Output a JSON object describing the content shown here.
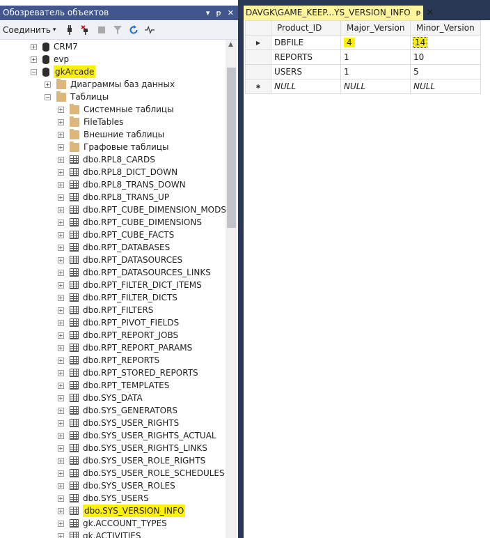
{
  "object_explorer": {
    "title": "Обозреватель объектов",
    "title_controls": [
      "▾",
      "ᵽ",
      "✕"
    ],
    "connect_label": "Соединить",
    "tree": [
      {
        "label": "CRM7",
        "type": "database",
        "level": 0,
        "expander": "+"
      },
      {
        "label": "evp",
        "type": "database",
        "level": 0,
        "expander": "+"
      },
      {
        "label": "gkArcade",
        "type": "database",
        "level": 0,
        "expander": "−",
        "highlight": true
      },
      {
        "label": "Диаграммы баз данных",
        "type": "folder",
        "level": 1,
        "expander": "+"
      },
      {
        "label": "Таблицы",
        "type": "folder",
        "level": 1,
        "expander": "−"
      },
      {
        "label": "Системные таблицы",
        "type": "folder",
        "level": 2,
        "expander": "+"
      },
      {
        "label": "FileTables",
        "type": "folder",
        "level": 2,
        "expander": "+"
      },
      {
        "label": "Внешние таблицы",
        "type": "folder",
        "level": 2,
        "expander": "+"
      },
      {
        "label": "Графовые таблицы",
        "type": "folder",
        "level": 2,
        "expander": "+"
      },
      {
        "label": "dbo.RPL8_CARDS",
        "type": "table",
        "level": 2,
        "expander": "+"
      },
      {
        "label": "dbo.RPL8_DICT_DOWN",
        "type": "table",
        "level": 2,
        "expander": "+"
      },
      {
        "label": "dbo.RPL8_TRANS_DOWN",
        "type": "table",
        "level": 2,
        "expander": "+"
      },
      {
        "label": "dbo.RPL8_TRANS_UP",
        "type": "table",
        "level": 2,
        "expander": "+"
      },
      {
        "label": "dbo.RPT_CUBE_DIMENSION_MODS",
        "type": "table",
        "level": 2,
        "expander": "+"
      },
      {
        "label": "dbo.RPT_CUBE_DIMENSIONS",
        "type": "table",
        "level": 2,
        "expander": "+"
      },
      {
        "label": "dbo.RPT_CUBE_FACTS",
        "type": "table",
        "level": 2,
        "expander": "+"
      },
      {
        "label": "dbo.RPT_DATABASES",
        "type": "table",
        "level": 2,
        "expander": "+"
      },
      {
        "label": "dbo.RPT_DATASOURCES",
        "type": "table",
        "level": 2,
        "expander": "+"
      },
      {
        "label": "dbo.RPT_DATASOURCES_LINKS",
        "type": "table",
        "level": 2,
        "expander": "+"
      },
      {
        "label": "dbo.RPT_FILTER_DICT_ITEMS",
        "type": "table",
        "level": 2,
        "expander": "+"
      },
      {
        "label": "dbo.RPT_FILTER_DICTS",
        "type": "table",
        "level": 2,
        "expander": "+"
      },
      {
        "label": "dbo.RPT_FILTERS",
        "type": "table",
        "level": 2,
        "expander": "+"
      },
      {
        "label": "dbo.RPT_PIVOT_FIELDS",
        "type": "table",
        "level": 2,
        "expander": "+"
      },
      {
        "label": "dbo.RPT_REPORT_JOBS",
        "type": "table",
        "level": 2,
        "expander": "+"
      },
      {
        "label": "dbo.RPT_REPORT_PARAMS",
        "type": "table",
        "level": 2,
        "expander": "+"
      },
      {
        "label": "dbo.RPT_REPORTS",
        "type": "table",
        "level": 2,
        "expander": "+"
      },
      {
        "label": "dbo.RPT_STORED_REPORTS",
        "type": "table",
        "level": 2,
        "expander": "+"
      },
      {
        "label": "dbo.RPT_TEMPLATES",
        "type": "table",
        "level": 2,
        "expander": "+"
      },
      {
        "label": "dbo.SYS_DATA",
        "type": "table",
        "level": 2,
        "expander": "+"
      },
      {
        "label": "dbo.SYS_GENERATORS",
        "type": "table",
        "level": 2,
        "expander": "+"
      },
      {
        "label": "dbo.SYS_USER_RIGHTS",
        "type": "table",
        "level": 2,
        "expander": "+"
      },
      {
        "label": "dbo.SYS_USER_RIGHTS_ACTUAL",
        "type": "table",
        "level": 2,
        "expander": "+"
      },
      {
        "label": "dbo.SYS_USER_RIGHTS_LINKS",
        "type": "table",
        "level": 2,
        "expander": "+"
      },
      {
        "label": "dbo.SYS_USER_ROLE_RIGHTS",
        "type": "table",
        "level": 2,
        "expander": "+"
      },
      {
        "label": "dbo.SYS_USER_ROLE_SCHEDULES",
        "type": "table",
        "level": 2,
        "expander": "+"
      },
      {
        "label": "dbo.SYS_USER_ROLES",
        "type": "table",
        "level": 2,
        "expander": "+"
      },
      {
        "label": "dbo.SYS_USERS",
        "type": "table",
        "level": 2,
        "expander": "+"
      },
      {
        "label": "dbo.SYS_VERSION_INFO",
        "type": "table",
        "level": 2,
        "expander": "+",
        "highlight": true
      },
      {
        "label": "gk.ACCOUNT_TYPES",
        "type": "table",
        "level": 2,
        "expander": "+"
      },
      {
        "label": "gk.ACTIVITIES",
        "type": "table",
        "level": 2,
        "expander": "+"
      }
    ]
  },
  "results": {
    "tab_title": "DAVGK\\GAME_KEEP...YS_VERSION_INFO",
    "tab_pin": "ᵽ",
    "tab_close": "✕",
    "columns": [
      "Product_ID",
      "Major_Version",
      "Minor_Version"
    ],
    "rows": [
      {
        "marker": "▶",
        "cells": [
          "DBFILE",
          "4",
          "14"
        ]
      },
      {
        "marker": "",
        "cells": [
          "REPORTS",
          "1",
          "10"
        ]
      },
      {
        "marker": "",
        "cells": [
          "USERS",
          "1",
          "5"
        ]
      },
      {
        "marker": "✱",
        "cells": [
          "NULL",
          "NULL",
          "NULL"
        ],
        "is_new": true
      }
    ]
  },
  "colors": {
    "titlebar": "#40568d",
    "dark_chrome": "#293955",
    "highlight": "#fff200",
    "tab_active": "#fff59d"
  }
}
